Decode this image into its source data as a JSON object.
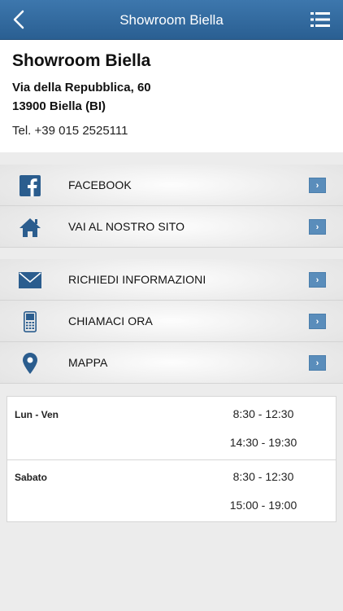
{
  "navbar": {
    "title": "Showroom Biella",
    "back_icon": "chevron-left-icon",
    "menu_icon": "list-menu-icon"
  },
  "store": {
    "name": "Showroom Biella",
    "address_line1": "Via della Repubblica, 60",
    "address_line2": "13900 Biella (BI)",
    "phone": "Tel. +39 015 2525111"
  },
  "menu_group1": [
    {
      "label": "FACEBOOK",
      "icon": "facebook-icon"
    },
    {
      "label": "VAI AL NOSTRO SITO",
      "icon": "home-icon"
    }
  ],
  "menu_group2": [
    {
      "label": "RICHIEDI INFORMAZIONI",
      "icon": "envelope-icon"
    },
    {
      "label": "CHIAMACI ORA",
      "icon": "phone-icon"
    },
    {
      "label": "MAPPA",
      "icon": "map-pin-icon"
    }
  ],
  "arrow_glyph": "›",
  "hours": [
    {
      "day": "Lun - Ven",
      "times": [
        "8:30 - 12:30",
        "14:30 - 19:30"
      ]
    },
    {
      "day": "Sabato",
      "times": [
        "8:30 - 12:30",
        "15:00 - 19:00"
      ]
    }
  ],
  "colors": {
    "navbar": "#3d77ad",
    "accent": "#5a8dbb",
    "icon": "#2b5d8e"
  }
}
